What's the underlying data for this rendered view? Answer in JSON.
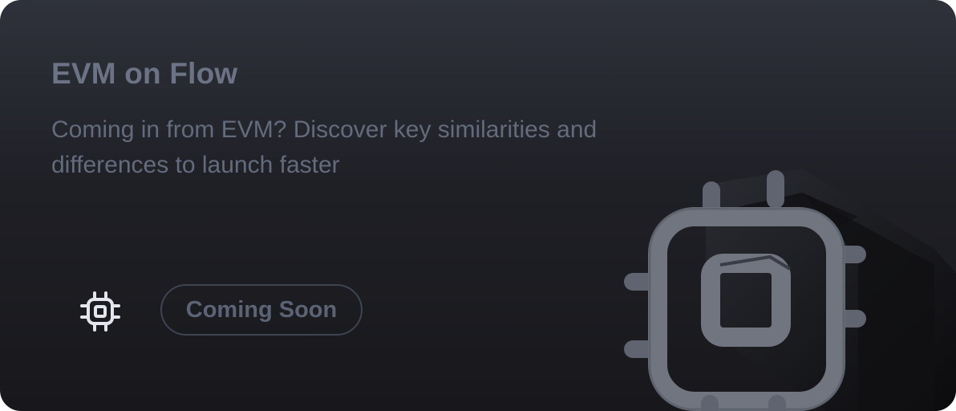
{
  "card": {
    "title": "EVM on Flow",
    "description": "Coming in from EVM? Discover key similarities and differences to launch faster",
    "status_label": "Coming Soon",
    "icon": "chip-icon",
    "illustration": "chip-icon"
  },
  "colors": {
    "background_top": "#2f323b",
    "background_bottom": "#18181c",
    "title": "#6b7384",
    "text": "#636b7c",
    "badge_border": "#3e4451",
    "chip": "#6e7380"
  }
}
